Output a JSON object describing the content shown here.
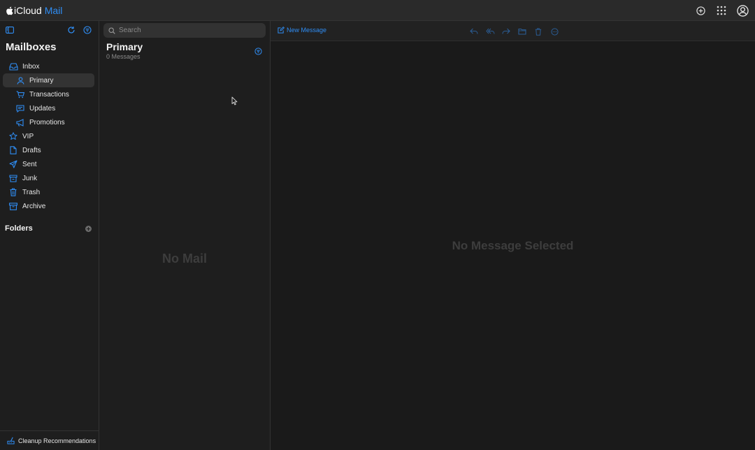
{
  "brand": {
    "apple_glyph": "",
    "name": "iCloud",
    "app": "Mail"
  },
  "topbar": {
    "icons": [
      "add-circle-icon",
      "app-grid-icon",
      "account-icon"
    ]
  },
  "sidebar": {
    "title": "Mailboxes",
    "tools": [
      "sidebar-toggle-icon",
      "refresh-icon",
      "filter-icon"
    ],
    "mailboxes": [
      {
        "label": "Inbox",
        "icon": "tray-icon",
        "level": 0
      },
      {
        "label": "Primary",
        "icon": "person-icon",
        "level": 1,
        "selected": true
      },
      {
        "label": "Transactions",
        "icon": "cart-icon",
        "level": 1
      },
      {
        "label": "Updates",
        "icon": "message-icon",
        "level": 1
      },
      {
        "label": "Promotions",
        "icon": "megaphone-icon",
        "level": 1
      },
      {
        "label": "VIP",
        "icon": "star-icon",
        "level": 0
      },
      {
        "label": "Drafts",
        "icon": "document-icon",
        "level": 0
      },
      {
        "label": "Sent",
        "icon": "paperplane-icon",
        "level": 0
      },
      {
        "label": "Junk",
        "icon": "junk-icon",
        "level": 0
      },
      {
        "label": "Trash",
        "icon": "trash-icon",
        "level": 0
      },
      {
        "label": "Archive",
        "icon": "archive-icon",
        "level": 0
      }
    ],
    "folders_label": "Folders",
    "cleanup_label": "Cleanup Recommendations"
  },
  "message_list": {
    "search_placeholder": "Search",
    "title": "Primary",
    "count": "0 Messages",
    "empty": "No Mail"
  },
  "reader": {
    "new_message_label": "New Message",
    "actions": [
      "reply-icon",
      "reply-all-icon",
      "forward-icon",
      "move-folder-icon",
      "trash-icon",
      "more-icon"
    ],
    "empty": "No Message Selected"
  },
  "colors": {
    "accent": "#2f8df4",
    "background": "#1e1e1e",
    "reader_bg": "#1a1a1a",
    "muted_text": "#3d3d3d"
  }
}
